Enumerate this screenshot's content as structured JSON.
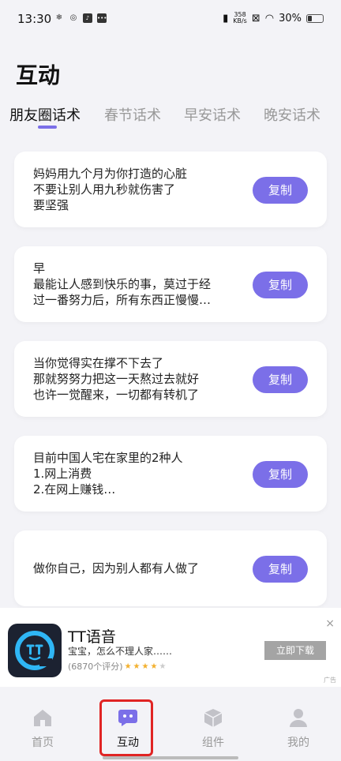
{
  "status_bar": {
    "time": "13:30",
    "net_speed_value": "358",
    "net_speed_unit": "KB/s",
    "battery": "30%",
    "battery_level": 0.3
  },
  "page": {
    "title": "互动"
  },
  "tabs": [
    {
      "label": "朋友圈话术",
      "active": true
    },
    {
      "label": "春节话术",
      "active": false
    },
    {
      "label": "早安话术",
      "active": false
    },
    {
      "label": "晚安话术",
      "active": false
    }
  ],
  "cards": [
    {
      "lines": [
        "妈妈用九个月为你打造的心脏",
        "不要让别人用九秒就伤害了",
        "要坚强"
      ],
      "button": "复制"
    },
    {
      "lines": [
        "早",
        "最能让人感到快乐的事，莫过于经",
        "过一番努力后，所有东西正慢慢…"
      ],
      "button": "复制"
    },
    {
      "lines": [
        "当你觉得实在撑不下去了",
        "那就努努力把这一天熬过去就好",
        "也许一觉醒来，一切都有转机了"
      ],
      "button": "复制"
    },
    {
      "lines": [
        "目前中国人宅在家里的2种人",
        "1.网上消费",
        "2.在网上赚钱…"
      ],
      "button": "复制"
    },
    {
      "lines": [
        "做你自己，因为别人都有人做了"
      ],
      "button": "复制"
    }
  ],
  "ad": {
    "title": "TT语音",
    "subtitle": "宝宝，怎么不理人家……",
    "rating_text": "(6870个评分)",
    "rating_stars": 4,
    "download": "立即下载",
    "close": "×",
    "tag": "广告"
  },
  "bottom_nav": [
    {
      "label": "首页",
      "icon": "home-icon",
      "active": false
    },
    {
      "label": "互动",
      "icon": "chat-icon",
      "active": true
    },
    {
      "label": "组件",
      "icon": "cube-icon",
      "active": false
    },
    {
      "label": "我的",
      "icon": "user-icon",
      "active": false
    }
  ],
  "colors": {
    "accent": "#7b6fe8",
    "highlight": "#e02424",
    "background": "#f3f3f7"
  }
}
